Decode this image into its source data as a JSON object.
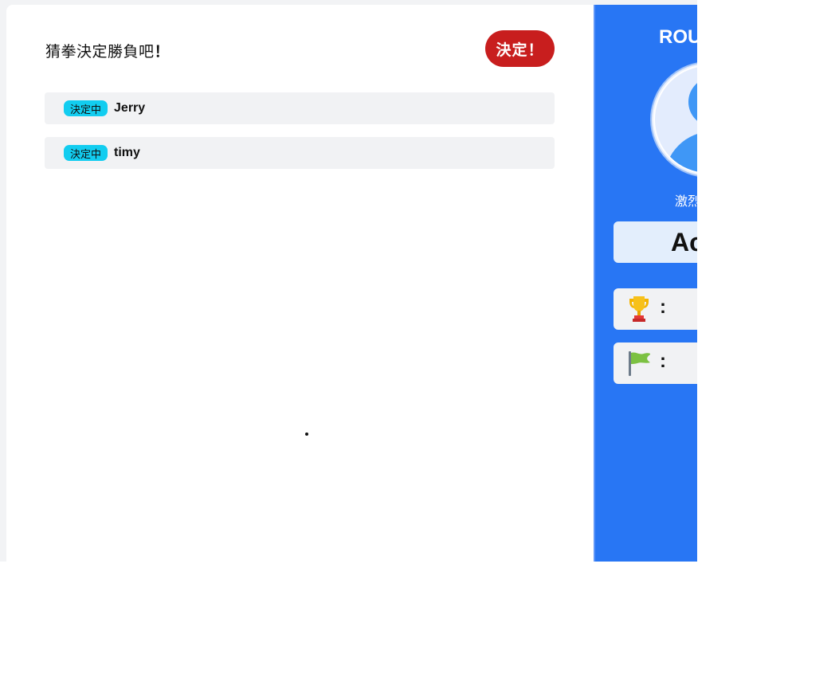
{
  "game": {
    "title": "猜拳決定勝負吧",
    "title_emphasis": "！",
    "decide_button": "決定！"
  },
  "players": [
    {
      "status": "決定中",
      "name": "Jerry"
    },
    {
      "status": "決定中",
      "name": "timy"
    }
  ],
  "side": {
    "round_label": "ROU",
    "avatar_caption": "激烈",
    "name_box_text": "Ac",
    "stats": [
      {
        "icon": "trophy-icon",
        "separator": ":"
      },
      {
        "icon": "flag-icon",
        "separator": ":"
      }
    ]
  },
  "colors": {
    "accent_blue": "#2876f4",
    "decide_red": "#c81e1e",
    "status_cyan": "#12cdf0"
  }
}
